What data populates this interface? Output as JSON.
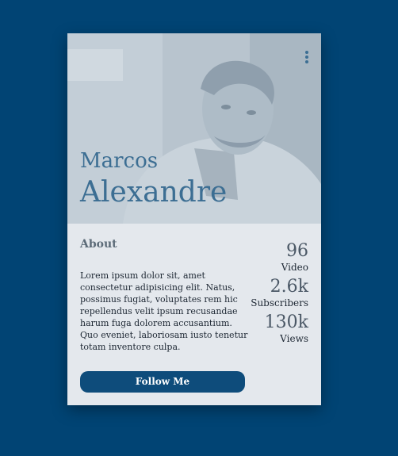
{
  "profile": {
    "first_name": "Marcos",
    "last_name": "Alexandre"
  },
  "about": {
    "heading": "About",
    "text": "Lorem ipsum dolor sit, amet consectetur adipisicing elit. Natus, possimus fugiat, voluptates rem hic repellendus velit ipsum recusandae harum fuga dolorem accusantium. Quo eveniet, laboriosam iusto tenetur totam inventore culpa."
  },
  "stats": [
    {
      "value": "96",
      "label": "Video"
    },
    {
      "value": "2.6k",
      "label": "Subscribers"
    },
    {
      "value": "130k",
      "label": "Views"
    }
  ],
  "actions": {
    "follow_label": "Follow Me"
  },
  "icons": {
    "menu": "more-vertical-icon"
  },
  "colors": {
    "page_background": "#014474",
    "card_background": "#e4e8ed",
    "accent": "#3c6e93",
    "button": "#0e4c7b"
  }
}
